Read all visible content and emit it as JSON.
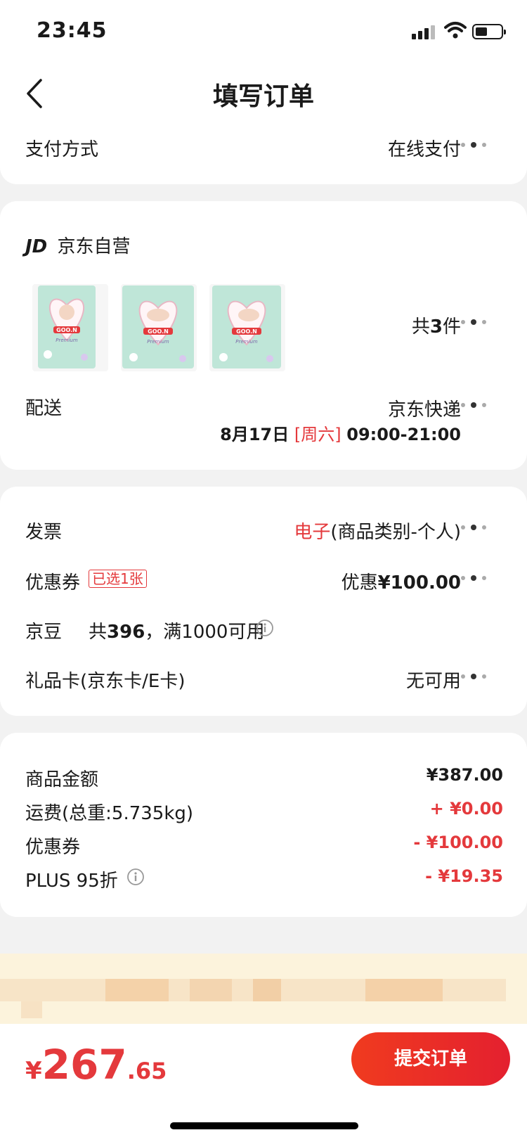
{
  "status_bar": {
    "time": "23:45"
  },
  "nav": {
    "title": "填写订单"
  },
  "payment": {
    "label": "支付方式",
    "value": "在线支付"
  },
  "shop": {
    "logo_text": "JD",
    "name": "京东自营",
    "items_count_prefix": "共",
    "items_count": "3",
    "items_count_suffix": "件",
    "products": [
      {
        "brand": "GOO.N",
        "line": "Premium"
      },
      {
        "brand": "GOO.N",
        "line": "Premium"
      },
      {
        "brand": "GOO.N",
        "line": "Premium"
      }
    ]
  },
  "delivery": {
    "label": "配送",
    "method": "京东快递",
    "date": "8月17日",
    "weekday": "[周六]",
    "time_range": "09:00-21:00"
  },
  "invoice": {
    "label": "发票",
    "type": "电子",
    "detail": "(商品类别-个人)"
  },
  "coupon": {
    "label": "优惠券",
    "tag": "已选1张",
    "value_prefix": "优惠",
    "value": "¥100.00"
  },
  "jingdou": {
    "label": "京豆",
    "text_prefix": "共",
    "count": "396",
    "text_suffix": "，满1000可用"
  },
  "gift_card": {
    "label": "礼品卡(京东卡/E卡)",
    "value": "无可用"
  },
  "summary": {
    "items": [
      {
        "label": "商品金额",
        "value": "¥387.00",
        "red": false
      },
      {
        "label": "运费(总重:5.735kg)",
        "value": "+ ¥0.00",
        "red": true
      },
      {
        "label": "优惠券",
        "value": "- ¥100.00",
        "red": true
      },
      {
        "label": "PLUS 95折",
        "value": "- ¥19.35",
        "red": true
      }
    ]
  },
  "footer": {
    "currency": "¥",
    "total_int": "267",
    "total_dec": ".65",
    "submit_label": "提交订单"
  },
  "colors": {
    "accent": "#e4393c",
    "background": "#f2f2f2"
  }
}
